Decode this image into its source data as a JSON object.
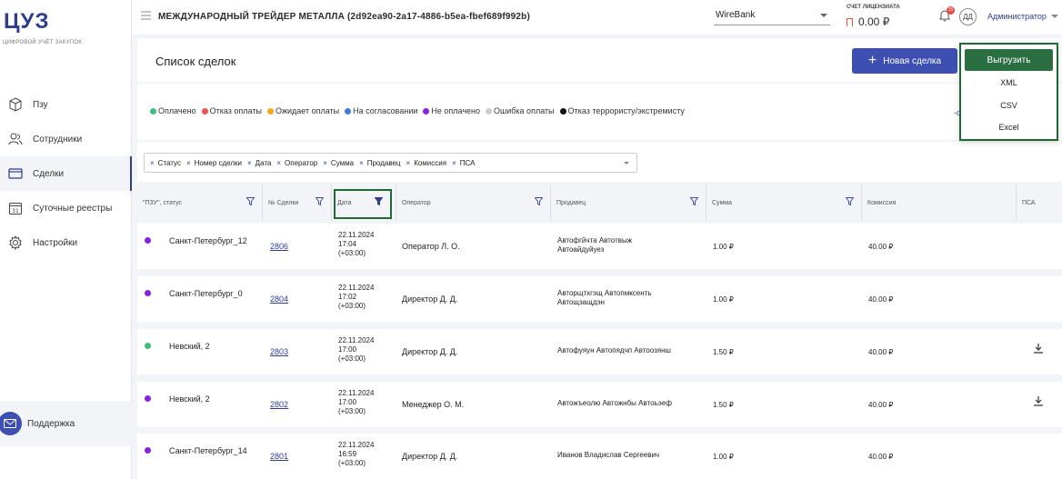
{
  "app": {
    "logo": "ЦУЗ",
    "logo_sub": "ЦИФРОВОЙ УЧЁТ ЗАКУПОК"
  },
  "sidebar": {
    "items": [
      {
        "label": "Пзу",
        "icon": "cube-icon"
      },
      {
        "label": "Сотрудники",
        "icon": "users-icon"
      },
      {
        "label": "Сделки",
        "icon": "card-icon",
        "active": true
      },
      {
        "label": "Суточные реестры",
        "icon": "calendar-icon"
      },
      {
        "label": "Настройки",
        "icon": "gear-icon"
      }
    ],
    "support_label": "Поддержка"
  },
  "header": {
    "org_title": "МЕЖДУНАРОДНЫЙ ТРЕЙДЕР МЕТАЛЛА (2d92ea90-2a17-4886-b5ea-fbef689f992b)",
    "bank": "WireBank",
    "account_label": "СЧЕТ ЛИЦЕНЗИАТА",
    "account_value": "0.00 ₽",
    "bell_badge": "25",
    "avatar": "ДД",
    "user": "Администратор"
  },
  "page": {
    "title": "Список сделок",
    "new_button": "Новая сделка"
  },
  "legend": [
    {
      "label": "Оплачено",
      "color": "#3fbf7f"
    },
    {
      "label": "Отказ оплаты",
      "color": "#ef5350"
    },
    {
      "label": "Ожидает оплаты",
      "color": "#f5a623"
    },
    {
      "label": "На согласовании",
      "color": "#3d7be0"
    },
    {
      "label": "Не оплачено",
      "color": "#8a20e0"
    },
    {
      "label": "Ошибка оплаты",
      "color": "#cccccc"
    },
    {
      "label": "Отказ террористу/экстремисту",
      "color": "#111111"
    }
  ],
  "filter_chips": [
    "Статус",
    "Номер сделки",
    "Дата",
    "Оператор",
    "Сумма",
    "Продавец",
    "Комиссия",
    "ПСА"
  ],
  "columns": [
    "\"ПЗУ\", статус",
    "№ Сделки",
    "Дата",
    "Оператор",
    "Продавец",
    "Сумма",
    "Комиссия",
    "ПСА"
  ],
  "rows": [
    {
      "status_color": "#8a20e0",
      "pzu": "Санкт-Петербург_12",
      "num": "2806",
      "date": "22.11.2024",
      "time": "17:04",
      "tz": "(+03:00)",
      "operator": "Оператор Л. О.",
      "seller1": "Автофгйчта Автотвыж",
      "seller2": "Автоайдуйуез",
      "sum": "1.00 ₽",
      "commission": "40.00 ₽",
      "psa": false
    },
    {
      "status_color": "#8a20e0",
      "pzu": "Санкт-Петербург_0",
      "num": "2804",
      "date": "22.11.2024",
      "time": "17:02",
      "tz": "(+03:00)",
      "operator": "Директор Д. Д.",
      "seller1": "Авторщтхгэщ Автопмксенть",
      "seller2": "Автощзащдэн",
      "sum": "1.00 ₽",
      "commission": "40.00 ₽",
      "psa": false
    },
    {
      "status_color": "#3fbf7f",
      "pzu": "Невский, 2",
      "num": "2803",
      "date": "22.11.2024",
      "time": "17:00",
      "tz": "(+03:00)",
      "operator": "Директор Д. Д.",
      "seller1": "Автофуяун Автопядчп Автоозянш",
      "seller2": "",
      "sum": "1.50 ₽",
      "commission": "40.00 ₽",
      "psa": true
    },
    {
      "status_color": "#8a20e0",
      "pzu": "Невский, 2",
      "num": "2802",
      "date": "22.11.2024",
      "time": "17:00",
      "tz": "(+03:00)",
      "operator": "Менеджер О. М.",
      "seller1": "Автожъеолю Автожнбы Автоьэеф",
      "seller2": "",
      "sum": "1.50 ₽",
      "commission": "40.00 ₽",
      "psa": true
    },
    {
      "status_color": "#8a20e0",
      "pzu": "Санкт-Петербург_14",
      "num": "2801",
      "date": "22.11.2024",
      "time": "16:59",
      "tz": "(+03:00)",
      "operator": "Директор Д. Д.",
      "seller1": "Иванов Владислав Сергеевич",
      "seller2": "",
      "sum": "1.00 ₽",
      "commission": "40.00 ₽",
      "psa": false
    }
  ],
  "export": {
    "button": "Выгрузить",
    "options": [
      "XML",
      "CSV",
      "Excel"
    ]
  },
  "colors": {
    "accent": "#3d4fb0",
    "export_green": "#2a6e42",
    "highlight_border": "#1f6a34"
  }
}
